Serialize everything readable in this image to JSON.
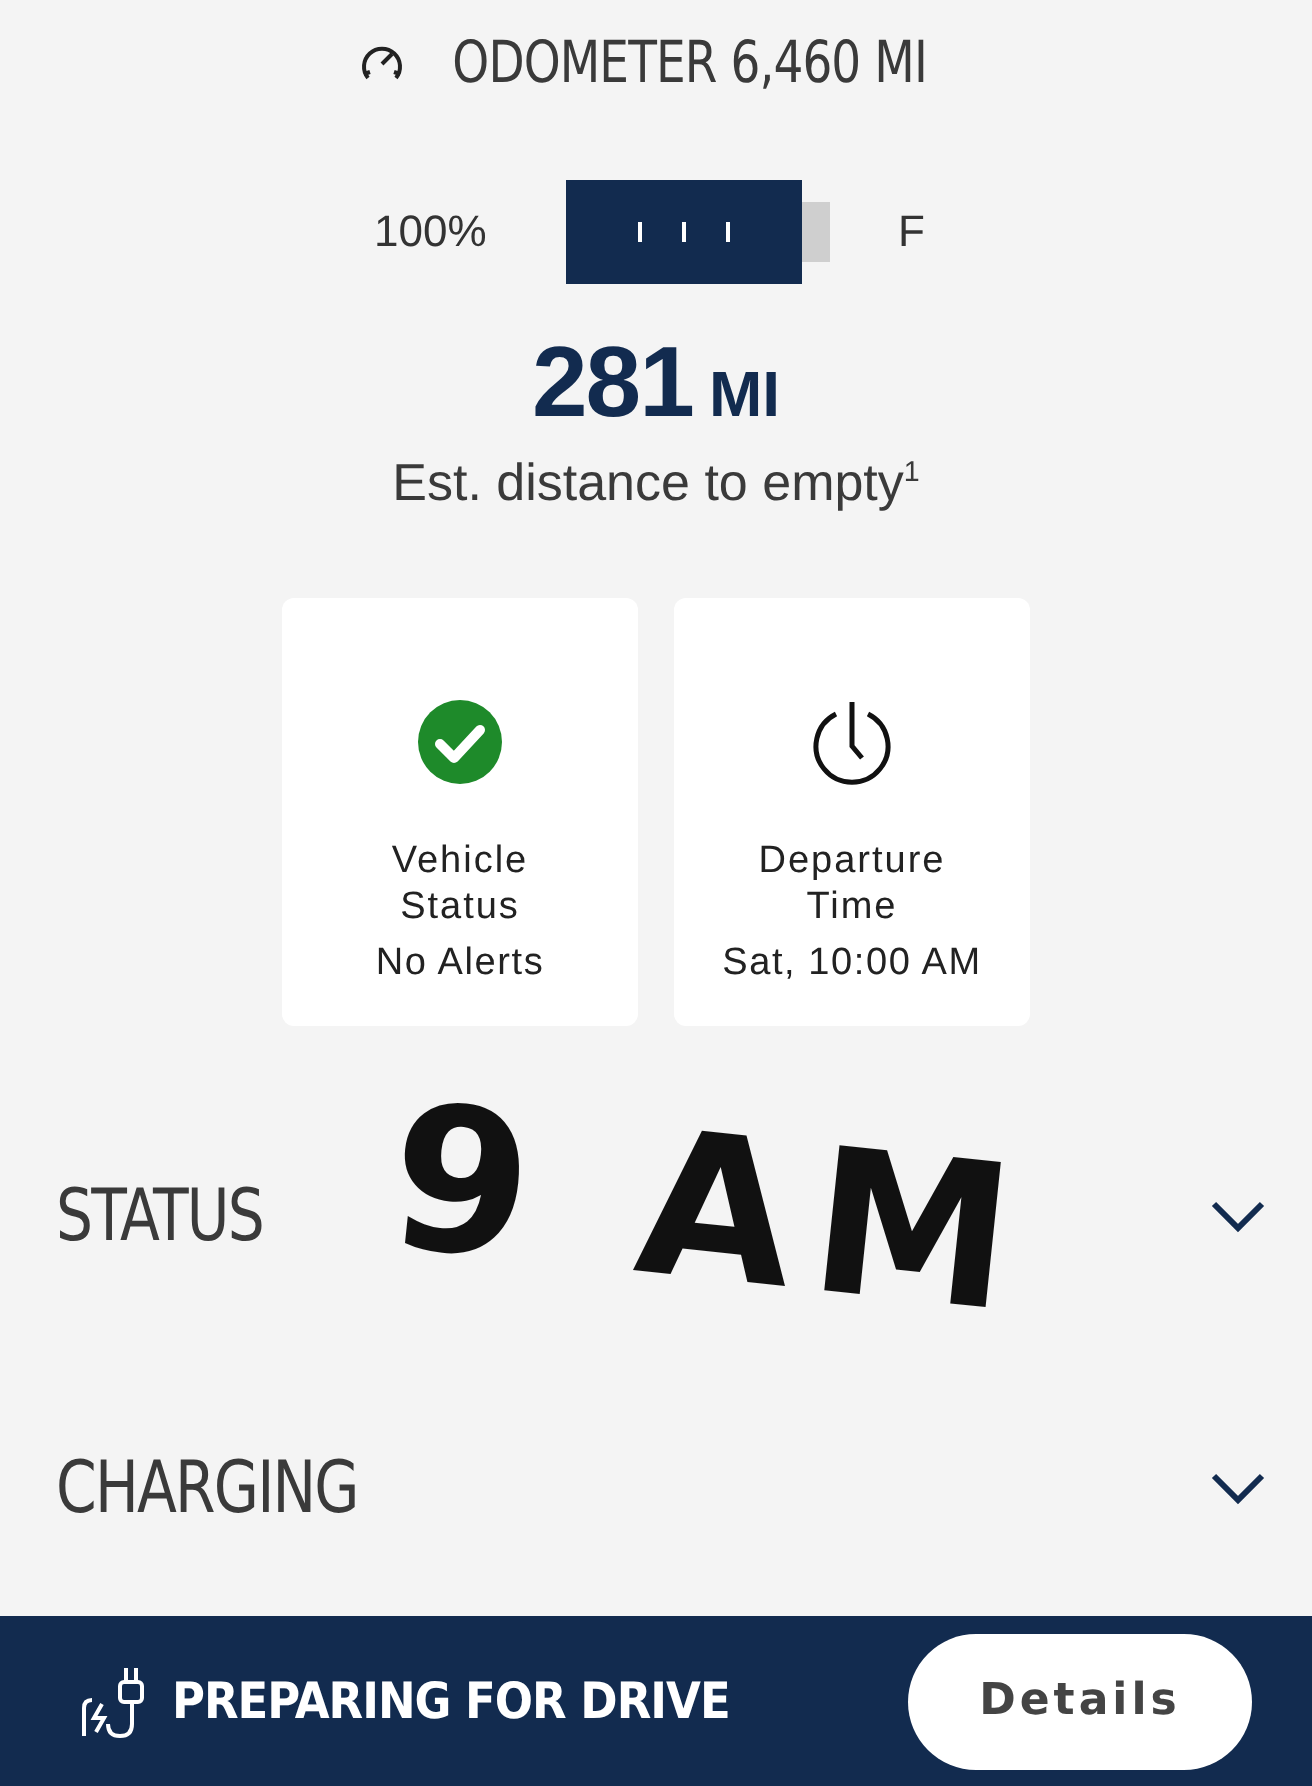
{
  "odometer": {
    "label": "ODOMETER 6,460 MI"
  },
  "battery": {
    "percent": "100%",
    "end_label": "F"
  },
  "range": {
    "value": "281",
    "unit": "MI",
    "caption": "Est. distance to empty$^{1}$"
  },
  "cards": [
    {
      "kind": "check",
      "title": "Vehicle Status",
      "detail": "No Alerts"
    },
    {
      "kind": "clock",
      "title": "Departure Time",
      "detail": "Sat, 10:00 AM"
    }
  ],
  "sections": [
    {
      "title": "STATUS",
      "expanded": false
    },
    {
      "title": "CHARGING",
      "expanded": false
    }
  ],
  "annotation": {
    "text": "9 AM"
  },
  "bottom_bar": {
    "status": "PREPARING FOR DRIVE",
    "button": "Details"
  }
}
